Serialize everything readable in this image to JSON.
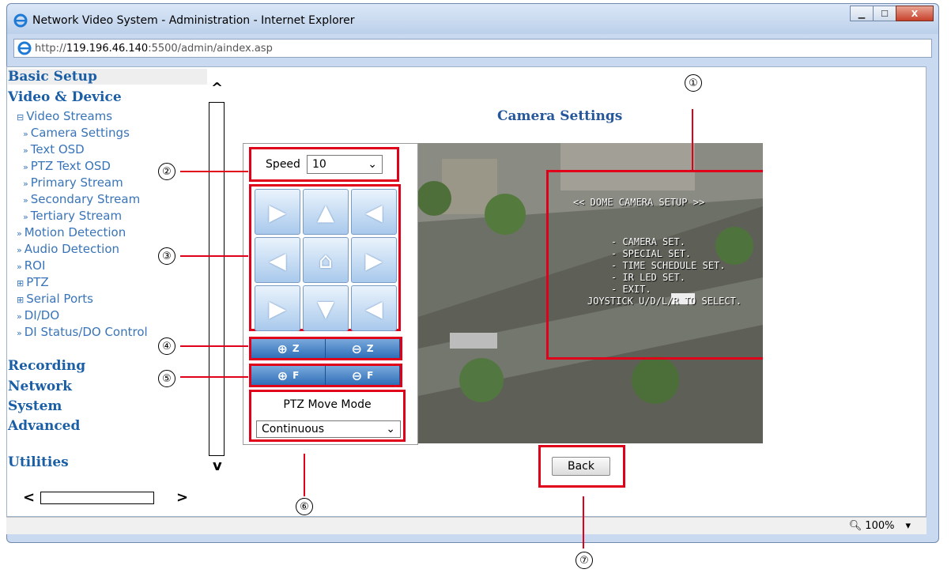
{
  "window": {
    "title": "Network Video System - Administration - Internet Explorer",
    "min_label": "▁",
    "max_label": "☐",
    "close_label": "X"
  },
  "address": {
    "scheme": "http://",
    "host": "119.196.46.140",
    "rest": ":5500/admin/aindex.asp"
  },
  "sidebar": {
    "sections": {
      "basic_setup": "Basic Setup",
      "video_device": "Video & Device",
      "recording": "Recording",
      "network": "Network",
      "system": "System",
      "advanced": "Advanced",
      "utilities": "Utilities"
    },
    "items": [
      {
        "glyph": "⊟",
        "label": "Video Streams"
      },
      {
        "glyph": "»",
        "label": "Camera Settings"
      },
      {
        "glyph": "»",
        "label": "Text OSD"
      },
      {
        "glyph": "»",
        "label": "PTZ Text OSD"
      },
      {
        "glyph": "»",
        "label": "Primary Stream"
      },
      {
        "glyph": "»",
        "label": "Secondary Stream"
      },
      {
        "glyph": "»",
        "label": "Tertiary Stream"
      },
      {
        "glyph": "»",
        "label": "Motion Detection"
      },
      {
        "glyph": "»",
        "label": "Audio Detection"
      },
      {
        "glyph": "»",
        "label": "ROI"
      },
      {
        "glyph": "⊞",
        "label": "PTZ"
      },
      {
        "glyph": "⊞",
        "label": "Serial Ports"
      },
      {
        "glyph": "»",
        "label": "DI/DO"
      },
      {
        "glyph": "»",
        "label": "DI Status/DO Control"
      }
    ],
    "scroll_up": "^",
    "scroll_down": "v",
    "scroll_left": "<",
    "scroll_right": ">"
  },
  "main": {
    "title": "Camera Settings",
    "speed_label": "Speed",
    "speed_value": "10",
    "pad": [
      {
        "glyph": "▶"
      },
      {
        "glyph": "▲"
      },
      {
        "glyph": "◀"
      },
      {
        "glyph": "◀"
      },
      {
        "glyph": "⌂"
      },
      {
        "glyph": "▶"
      },
      {
        "glyph": "▶"
      },
      {
        "glyph": "▼"
      },
      {
        "glyph": "◀"
      }
    ],
    "zoom_in_label": "Z",
    "zoom_out_label": "Z",
    "focus_near_label": "F",
    "focus_far_label": "F",
    "move_mode_label": "PTZ Move Mode",
    "move_mode_value": "Continuous",
    "back_label": "Back"
  },
  "osd": {
    "lines": [
      "<< DOME CAMERA SETUP >>",
      "- CAMERA SET.",
      "- SPECIAL SET.",
      "- TIME SCHEDULE SET.",
      "- IR LED SET.",
      "- EXIT.",
      "JOYSTICK U/D/L/R TO SELECT."
    ]
  },
  "status": {
    "zoom": "100%"
  },
  "callouts": [
    "①",
    "②",
    "③",
    "④",
    "⑤",
    "⑥",
    "⑦"
  ],
  "colors": {
    "highlight": "#e0001a",
    "nav_section": "#1a5ea6",
    "nav_item": "#3974b8"
  }
}
